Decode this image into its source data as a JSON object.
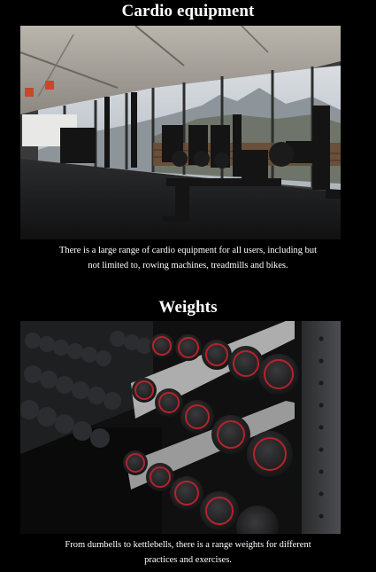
{
  "sections": [
    {
      "title": "Cardio equipment",
      "image_alt": "gym-photo-cardio",
      "caption": "There is a large range of cardio equipment for all users, including but not limited to, rowing machines, treadmills and bikes."
    },
    {
      "title": "Weights",
      "image_alt": "gym-photo-dumbbells",
      "caption": "From dumbells to kettlebells, there is a range weights for different practices and exercises."
    }
  ],
  "colors": {
    "background": "#000000",
    "text": "#ffffff",
    "dumbbell_accent": "#b4232c"
  }
}
